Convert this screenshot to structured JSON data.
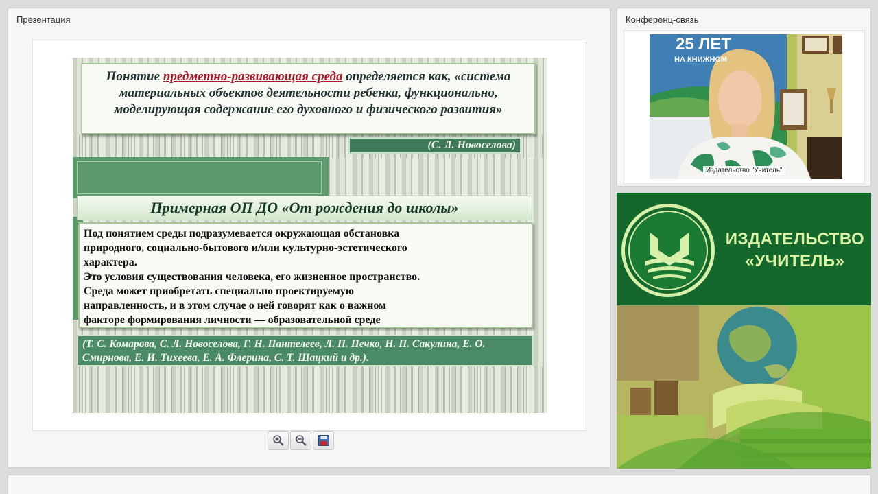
{
  "presentation": {
    "panel_title": "Презентация",
    "slide": {
      "definition_prefix": "Понятие ",
      "definition_term": "предметно-развивающая среда",
      "definition_suffix": " определяется как, «система материальных объектов деятельности ребенка, функционально,  моделирующая содержание его духовного и физического развития»",
      "definition_author": "(С. Л. Новоселова)",
      "program_title": "Примерная ОП ДО «От рождения до школы»",
      "body_lines": [
        "Под понятием среды подразумевается окружающая обстановка",
        "природного, социально-бытового и/или культурно-эстетического",
        "характера.",
        "Это условия существования человека, его жизненное пространство.",
        "Среда может приобретать специально проектируемую",
        "направленность, и в этом случае о ней говорят как о важном",
        "факторе формирования личности — образовательной среде"
      ],
      "references": "(Т. С. Комарова, С. Л. Новоселова, Г. Н. Пантелеев, Л. П. Печко, Н. П. Сакулина, Е. О. Смирнова, Е. И. Тихеева, Е. А. Флерина, С. Т. Шацкий и др.)."
    },
    "tools": [
      {
        "icon": "zoom-in-icon"
      },
      {
        "icon": "zoom-out-icon"
      },
      {
        "icon": "save-icon"
      }
    ]
  },
  "conference": {
    "panel_title": "Конференц-связь",
    "video_banner_text": "25 ЛЕТ",
    "video_banner_sub": "НА КНИЖНОМ",
    "video_label": "Издательство \"Учитель\""
  },
  "ad": {
    "brand_line1": "ИЗДАТЕЛЬСТВО",
    "brand_line2": "«УЧИТЕЛЬ»"
  },
  "colors": {
    "slide_green": "#4a8a66",
    "accent_red": "#b0182a",
    "ad_green": "#14682b"
  }
}
